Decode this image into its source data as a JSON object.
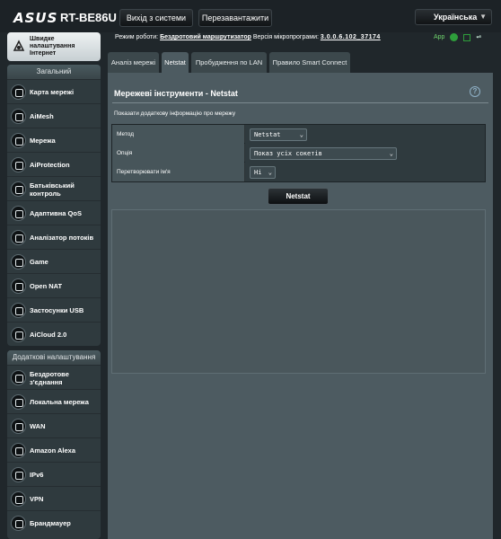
{
  "header": {
    "brand": "ASUS",
    "model": "RT-BE86U",
    "logout_label": "Вихід з системи",
    "reboot_label": "Перезавантажити",
    "language": "Українська"
  },
  "status": {
    "mode_label": "Режим роботи:",
    "mode_value": "Бездротовий маршрутизатор",
    "firmware_label": "Версія мікропрограми:",
    "firmware_value": "3.0.0.6.102_37174",
    "app_label": "App"
  },
  "sidebar": {
    "quick": "Швидке налаштування Інтернет",
    "general_header": "Загальний",
    "general_items": [
      {
        "label": "Карта мережі",
        "icon": "network-map-icon"
      },
      {
        "label": "AiMesh",
        "icon": "aimesh-icon"
      },
      {
        "label": "Мережа",
        "icon": "network-icon"
      },
      {
        "label": "AiProtection",
        "icon": "aiprotection-icon"
      },
      {
        "label": "Батьківський контроль",
        "icon": "parental-control-icon"
      },
      {
        "label": "Адаптивна QoS",
        "icon": "qos-icon"
      },
      {
        "label": "Аналізатор потоків",
        "icon": "traffic-analyzer-icon"
      },
      {
        "label": "Game",
        "icon": "game-icon"
      },
      {
        "label": "Open NAT",
        "icon": "open-nat-icon"
      },
      {
        "label": "Застосунки USB",
        "icon": "usb-icon"
      },
      {
        "label": "AiCloud 2.0",
        "icon": "aicloud-icon"
      }
    ],
    "advanced_header": "Додаткові налаштування",
    "advanced_items": [
      {
        "label": "Бездротове з'єднання",
        "icon": "wireless-icon"
      },
      {
        "label": "Локальна мережа",
        "icon": "lan-icon"
      },
      {
        "label": "WAN",
        "icon": "wan-icon"
      },
      {
        "label": "Amazon Alexa",
        "icon": "alexa-icon"
      },
      {
        "label": "IPv6",
        "icon": "ipv6-icon"
      },
      {
        "label": "VPN",
        "icon": "vpn-icon"
      },
      {
        "label": "Брандмауер",
        "icon": "firewall-icon"
      }
    ]
  },
  "tabs": [
    "Аналіз мережі",
    "Netstat",
    "Пробудження по LAN",
    "Правило Smart Connect"
  ],
  "main": {
    "title": "Мережеві інструменти - Netstat",
    "description": "Показати додаткову інформацію про мережу",
    "fields": [
      {
        "label": "Метод",
        "value": "Netstat"
      },
      {
        "label": "Опція",
        "value": "Показ усіх сокетів"
      },
      {
        "label": "Перетворювати ім'я",
        "value": "Ні"
      }
    ],
    "button_label": "Netstat"
  },
  "colors": {
    "background": "#20272b",
    "panel": "#4d5b61",
    "accent_green": "#2e9e3b"
  }
}
